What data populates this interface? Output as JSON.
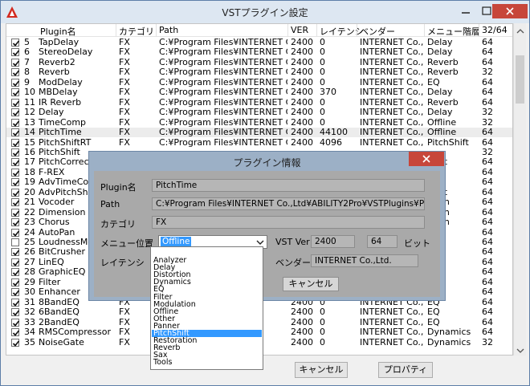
{
  "window": {
    "title": "VSTプラグイン設定"
  },
  "list": {
    "headers": {
      "plugin_name": "Plugin名",
      "category": "カテゴリ",
      "path": "Path",
      "ver": "VER",
      "latency": "レイテンシ",
      "vendor": "ベンダー",
      "menu": "メニュー階層",
      "bits": "32/64"
    },
    "rows": [
      {
        "checked": true,
        "no": "5",
        "name": "TapDelay",
        "cat": "FX",
        "path": "C:¥Program Files¥INTERNET Co.,Ltd.",
        "ver": "2400",
        "lat": "0",
        "vendor": "INTERNET Co.,Ltd.",
        "menu": "Delay",
        "bits": "64"
      },
      {
        "checked": true,
        "no": "6",
        "name": "StereoDelay",
        "cat": "FX",
        "path": "C:¥Program Files¥INTERNET Co.,Ltd.",
        "ver": "2400",
        "lat": "0",
        "vendor": "INTERNET Co.,Ltd.",
        "menu": "Delay",
        "bits": "64"
      },
      {
        "checked": true,
        "no": "7",
        "name": "Reverb2",
        "cat": "FX",
        "path": "C:¥Program Files¥INTERNET Co.,Ltd.",
        "ver": "2400",
        "lat": "0",
        "vendor": "INTERNET Co.,Ltd.",
        "menu": "Reverb",
        "bits": "64"
      },
      {
        "checked": true,
        "no": "8",
        "name": "Reverb",
        "cat": "FX",
        "path": "C:¥Program Files¥INTERNET Co.,Ltd.",
        "ver": "2400",
        "lat": "0",
        "vendor": "INTERNET Co.,Ltd.",
        "menu": "Reverb",
        "bits": "32"
      },
      {
        "checked": true,
        "no": "9",
        "name": "ModDelay",
        "cat": "FX",
        "path": "C:¥Program Files¥INTERNET Co.,Ltd.",
        "ver": "2400",
        "lat": "0",
        "vendor": "INTERNET Co.,Ltd.",
        "menu": "EQ",
        "bits": "64"
      },
      {
        "checked": true,
        "no": "10",
        "name": "MBDelay",
        "cat": "FX",
        "path": "C:¥Program Files¥INTERNET Co.,Ltd.",
        "ver": "2400",
        "lat": "370",
        "vendor": "INTERNET Co.,Ltd.",
        "menu": "Delay",
        "bits": "64"
      },
      {
        "checked": true,
        "no": "11",
        "name": "IR Reverb",
        "cat": "FX",
        "path": "C:¥Program Files¥INTERNET Co.,Ltd.",
        "ver": "2400",
        "lat": "0",
        "vendor": "INTERNET Co.,Ltd.",
        "menu": "Reverb",
        "bits": "64"
      },
      {
        "checked": true,
        "no": "12",
        "name": "Delay",
        "cat": "FX",
        "path": "C:¥Program Files¥INTERNET Co.,Ltd.",
        "ver": "2400",
        "lat": "0",
        "vendor": "INTERNET Co.,Ltd.",
        "menu": "Delay",
        "bits": "32"
      },
      {
        "checked": true,
        "no": "13",
        "name": "TimeComp",
        "cat": "FX",
        "path": "C:¥Program Files¥INTERNET Co.,Ltd.",
        "ver": "2400",
        "lat": "0",
        "vendor": "INTERNET Co.,Ltd.",
        "menu": "Offline",
        "bits": "32"
      },
      {
        "checked": true,
        "no": "14",
        "name": "PitchTime",
        "cat": "FX",
        "path": "C:¥Program Files¥INTERNET Co.,Ltd.",
        "ver": "2400",
        "lat": "44100",
        "vendor": "INTERNET Co.,Ltd.",
        "menu": "Offline",
        "bits": "64",
        "selected": true
      },
      {
        "checked": true,
        "no": "15",
        "name": "PitchShiftRT",
        "cat": "FX",
        "path": "C:¥Program Files¥INTERNET Co.,Ltd.",
        "ver": "2400",
        "lat": "4096",
        "vendor": "INTERNET Co.,Ltd.",
        "menu": "PitchShift",
        "bits": "64"
      },
      {
        "checked": true,
        "no": "16",
        "name": "PitchShift",
        "cat": "",
        "path": "",
        "ver": "",
        "lat": "",
        "vendor": "",
        "menu": "",
        "bits": "32"
      },
      {
        "checked": true,
        "no": "17",
        "name": "PitchCorrect",
        "cat": "",
        "path": "",
        "ver": "",
        "lat": "",
        "vendor": "",
        "menu": "Shift",
        "bits": "64"
      },
      {
        "checked": true,
        "no": "18",
        "name": "F-REX",
        "cat": "",
        "path": "",
        "ver": "",
        "lat": "",
        "vendor": "",
        "menu": "",
        "bits": "64"
      },
      {
        "checked": true,
        "no": "19",
        "name": "AdvTimeComp2",
        "cat": "",
        "path": "",
        "ver": "",
        "lat": "",
        "vendor": "",
        "menu": "",
        "bits": "64"
      },
      {
        "checked": true,
        "no": "20",
        "name": "AdvPitchShift2",
        "cat": "",
        "path": "",
        "ver": "",
        "lat": "",
        "vendor": "",
        "menu": "Shift",
        "bits": "64"
      },
      {
        "checked": true,
        "no": "21",
        "name": "Vocoder",
        "cat": "",
        "path": "",
        "ver": "",
        "lat": "",
        "vendor": "",
        "menu": "ation",
        "bits": "64"
      },
      {
        "checked": true,
        "no": "22",
        "name": "Dimension",
        "cat": "",
        "path": "",
        "ver": "",
        "lat": "",
        "vendor": "",
        "menu": "ation",
        "bits": "64"
      },
      {
        "checked": true,
        "no": "23",
        "name": "Chorus",
        "cat": "",
        "path": "",
        "ver": "",
        "lat": "",
        "vendor": "",
        "menu": "ation",
        "bits": "64"
      },
      {
        "checked": true,
        "no": "24",
        "name": "AutoPan",
        "cat": "",
        "path": "",
        "ver": "",
        "lat": "",
        "vendor": "",
        "menu": "",
        "bits": "64"
      },
      {
        "checked": false,
        "no": "25",
        "name": "LoudnessMeter",
        "cat": "",
        "path": "",
        "ver": "",
        "lat": "",
        "vendor": "",
        "menu": "er",
        "bits": "64"
      },
      {
        "checked": true,
        "no": "26",
        "name": "BitCrusher",
        "cat": "",
        "path": "",
        "ver": "",
        "lat": "",
        "vendor": "",
        "menu": "",
        "bits": "64"
      },
      {
        "checked": true,
        "no": "27",
        "name": "LinEQ",
        "cat": "",
        "path": "",
        "ver": "",
        "lat": "",
        "vendor": "",
        "menu": "",
        "bits": "64"
      },
      {
        "checked": true,
        "no": "28",
        "name": "GraphicEQ",
        "cat": "",
        "path": "",
        "ver": "",
        "lat": "",
        "vendor": "",
        "menu": "",
        "bits": "64"
      },
      {
        "checked": true,
        "no": "29",
        "name": "Filter",
        "cat": "",
        "path": "",
        "ver": "",
        "lat": "",
        "vendor": "",
        "menu": "",
        "bits": "64"
      },
      {
        "checked": true,
        "no": "30",
        "name": "Enhancer",
        "cat": "",
        "path": "",
        "ver": "",
        "lat": "",
        "vendor": "",
        "menu": "",
        "bits": "64"
      },
      {
        "checked": true,
        "no": "31",
        "name": "8BandEQ",
        "cat": "FX",
        "path": "",
        "ver": "2400",
        "lat": "0",
        "vendor": "INTERNET Co.,Ltd.",
        "menu": "EQ",
        "bits": "64"
      },
      {
        "checked": true,
        "no": "32",
        "name": "6BandEQ",
        "cat": "FX",
        "path": "",
        "ver": "2400",
        "lat": "0",
        "vendor": "INTERNET Co.,Ltd.",
        "menu": "EQ",
        "bits": "64"
      },
      {
        "checked": true,
        "no": "33",
        "name": "2BandEQ",
        "cat": "FX",
        "path": "",
        "ver": "2400",
        "lat": "0",
        "vendor": "INTERNET Co.,Ltd.",
        "menu": "EQ",
        "bits": "64"
      },
      {
        "checked": true,
        "no": "34",
        "name": "RMSCompressor",
        "cat": "FX",
        "path": "",
        "ver": "2400",
        "lat": "0",
        "vendor": "INTERNET Co.,Ltd.",
        "menu": "Dynamics",
        "bits": "64"
      },
      {
        "checked": true,
        "no": "35",
        "name": "NoiseGate",
        "cat": "FX",
        "path": "",
        "ver": "2400",
        "lat": "0",
        "vendor": "INTERNET Co.,Ltd.",
        "menu": "Dynamics",
        "bits": "32"
      }
    ]
  },
  "bottom_buttons": {
    "cancel": "キャンセル",
    "property": "プロパティ"
  },
  "dialog": {
    "title": "プラグイン情報",
    "plugin_label": "Plugin名",
    "plugin_value": "PitchTime",
    "path_label": "Path",
    "path_value": "C:¥Program Files¥INTERNET Co.,Ltd¥ABILITY2Pro¥VSTPlugins¥PitchTime¥PitchTim",
    "category_label": "カテゴリ",
    "category_value": "FX",
    "menu_label": "メニュー位置",
    "menu_value": "Offline",
    "vstver_label": "VST Ver",
    "vstver_value": "2400",
    "bits_value": "64",
    "bits_label": "ビット",
    "latency_label": "レイテンシ",
    "vendor_label": "ベンダー",
    "vendor_value": "INTERNET Co.,Ltd.",
    "cancel_label": "キャンセル"
  },
  "dropdown": {
    "options": [
      "Analyzer",
      "Delay",
      "Distortion",
      "Dynamics",
      "EQ",
      "Filter",
      "Modulation",
      "Offline",
      "Other",
      "Panner",
      "PitchShift",
      "Restoration",
      "Reverb",
      "Sax",
      "Tools"
    ],
    "highlighted": "PitchShift"
  },
  "colors": {
    "selection": "#3399ff",
    "close_button": "#c7463a",
    "dialog_bg": "#a9a9a9"
  }
}
